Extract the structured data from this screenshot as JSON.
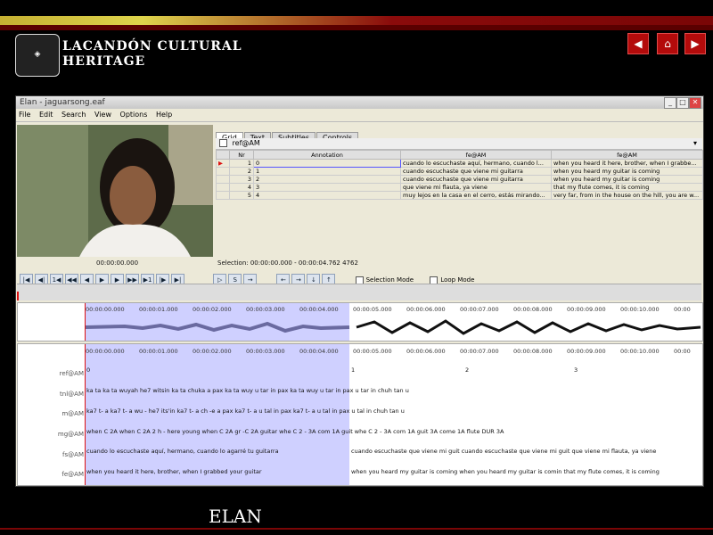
{
  "header": {
    "title_line1": "LACANDÓN CULTURAL",
    "title_line2": "HERITAGE",
    "nav": {
      "prev_icon": "arrow-left-icon",
      "home_icon": "home-icon",
      "next_icon": "arrow-right-icon"
    }
  },
  "window": {
    "title": "Elan - jaguarsong.eaf",
    "menu": [
      "File",
      "Edit",
      "Search",
      "View",
      "Options",
      "Help"
    ]
  },
  "tabs": [
    "Grid",
    "Text",
    "Subtitles",
    "Controls"
  ],
  "grid": {
    "tier": "ref@AM",
    "headers": [
      "Nr",
      "Annotation",
      "fe@AM",
      "fe@AM"
    ],
    "rows": [
      {
        "nr": "1",
        "ann": "0",
        "es": "cuando lo escuchaste aquí, hermano, cuando l...",
        "en": "when you heard it here, brother, when I grabbe..."
      },
      {
        "nr": "2",
        "ann": "1",
        "es": "cuando escuchaste que viene mi guitarra",
        "en": "when you heard my guitar is coming"
      },
      {
        "nr": "3",
        "ann": "2",
        "es": "cuando escuchaste que viene mi guitarra",
        "en": "when you heard my guitar is coming"
      },
      {
        "nr": "4",
        "ann": "3",
        "es": "que viene mi flauta, ya viene",
        "en": "that my flute comes, it is coming"
      },
      {
        "nr": "5",
        "ann": "4",
        "es": "muy lejos en la casa en el cerro, estás mirando...",
        "en": "very far, from in the house on the hill, you are w..."
      }
    ]
  },
  "media": {
    "time": "00:00:00.000",
    "selection": "Selection: 00:00:00.000 - 00:00:04.762  4762"
  },
  "modes": {
    "selection": "Selection Mode",
    "loop": "Loop Mode"
  },
  "ruler": [
    "00:00:00.000",
    "00:00:01.000",
    "00:00:02.000",
    "00:00:03.000",
    "00:00:04.000",
    "00:00:05.000",
    "00:00:06.000",
    "00:00:07.000",
    "00:00:08.000",
    "00:00:09.000",
    "00:00:10.000",
    "00:00"
  ],
  "tiers": [
    "ref@AM",
    "tnl@AM",
    "m@AM",
    "mg@AM",
    "fs@AM",
    "fe@AM"
  ],
  "tier_text": {
    "ref": [
      "0",
      "1",
      "2",
      "3"
    ],
    "tnl": "ka   ta   ka   ta   wuyah he7   witsin ka   ta   chuka a   pax      ka   ta   wuy u   tar   in   pax  ka  ta   wuy u   tar   in   pax u   tar   in   chuh  tan  u",
    "m": "ka7   t- a  ka7   t- a  wu - he7   its'in ka7   t- a  ch -e a   pax      ka7  t- a   u   tal   in   pax  ka7 t- a   u   tal   in   pax u   tal   in   chuh  tan  u",
    "mg": "when  C 2A when  C 2A 2 h - here   young when  C 2A gr -C 2A    guitar   whe  C 2   - 3A   com 1A   guit  whe C 2   - 3A  com 1A   guit 3A    come 1A   flute  DUR  3A",
    "fs_a": "cuando lo escuchaste aquí, hermano, cuando lo agarré tu guitarra",
    "fs_b": "cuando escuchaste que viene mi guit cuando escuchaste que viene mi guit que viene mi flauta, ya viene",
    "fe_a": "when you heard it here, brother, when I grabbed your guitar",
    "fe_b": "when you heard my guitar is coming   when you heard my guitar is comin  that my flute comes, it is coming"
  },
  "footer": {
    "label": "ELAN"
  }
}
